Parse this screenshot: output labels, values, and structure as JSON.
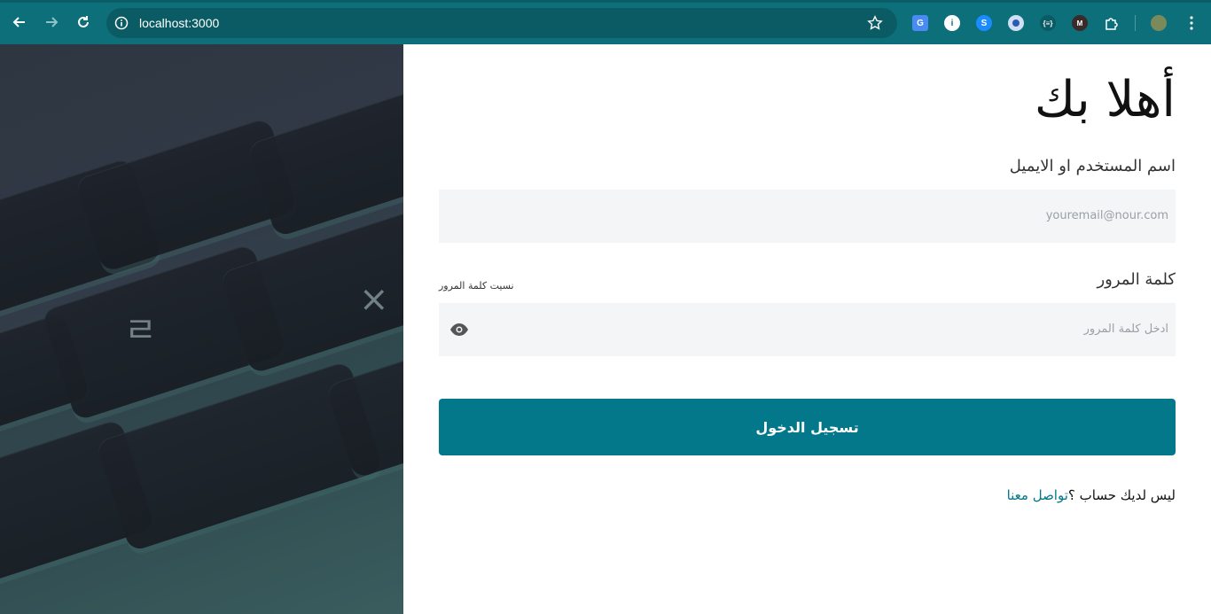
{
  "browser": {
    "url": "localhost:3000",
    "colors": {
      "chrome": "#0c6f7a",
      "omnibox": "#0a5b64"
    },
    "extensions": [
      "google-translate-icon",
      "info-extension-icon",
      "shazam-icon",
      "circle-extension-icon",
      "json-extension-icon",
      "m-extension-icon",
      "puzzle-icon",
      "profile-avatar"
    ]
  },
  "login": {
    "title": "أهلا بك",
    "username_label": "اسم المستخدم او الايميل",
    "username_placeholder": "youremail@nour.com",
    "password_label": "كلمة المرور",
    "forgot_password": "نسيت كلمة المرور",
    "password_placeholder": "ادخل كلمة المرور",
    "submit_label": "تسجيل الدخول",
    "no_account_text": "ليس لديك حساب ؟",
    "contact_link": "تواصل معنا",
    "colors": {
      "accent": "#02788a",
      "input_bg": "#f3f5f7"
    }
  }
}
